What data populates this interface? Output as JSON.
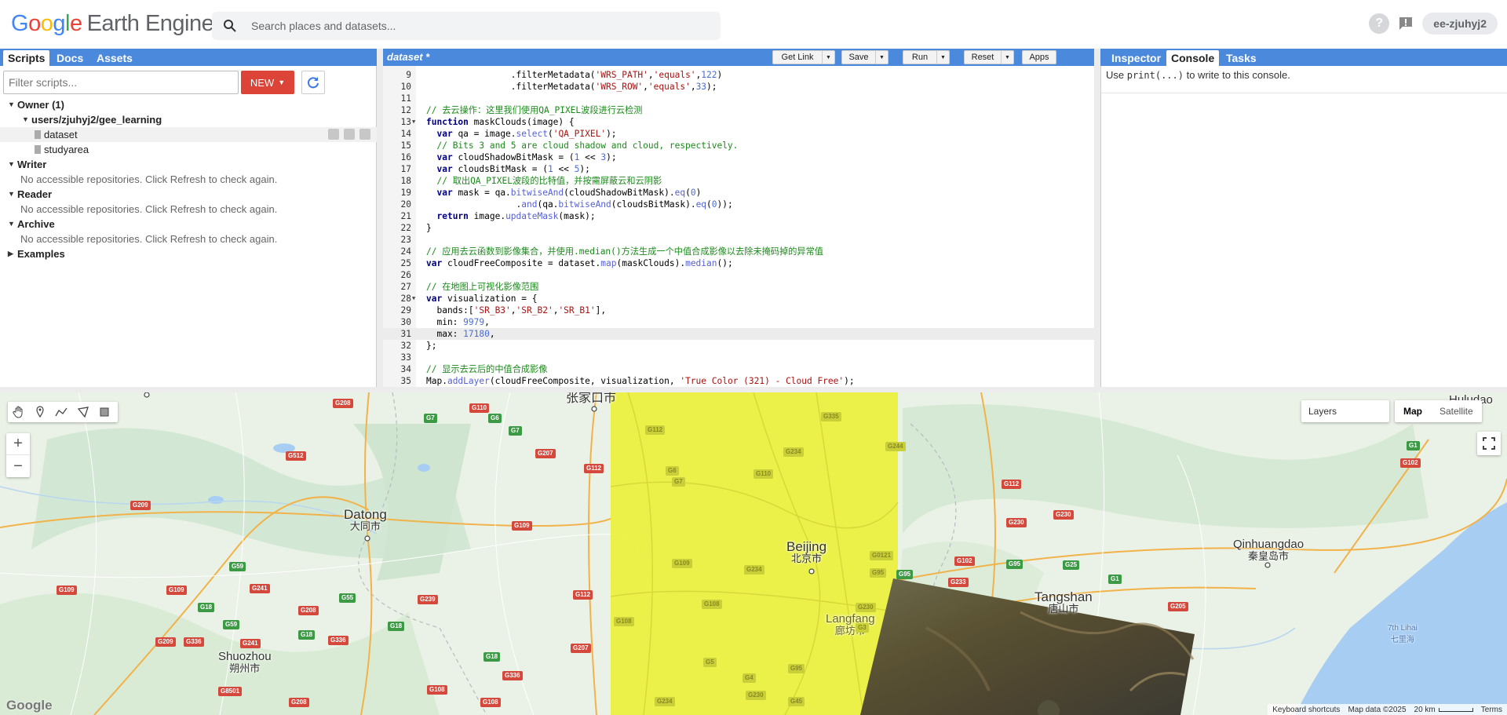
{
  "header": {
    "logo_google": "Google",
    "logo_product": "Earth Engine",
    "search_placeholder": "Search places and datasets...",
    "help_glyph": "?",
    "feedback_glyph": "!",
    "user": "ee-zjuhyj2"
  },
  "left_panel": {
    "tabs": [
      "Scripts",
      "Docs",
      "Assets"
    ],
    "active_tab": "Scripts",
    "filter_placeholder": "Filter scripts...",
    "new_label": "NEW",
    "tree": {
      "owner": "Owner (1)",
      "repo": "users/zjuhyj2/gee_learning",
      "files": [
        "dataset",
        "studyarea"
      ],
      "writer": "Writer",
      "writer_msg": "No accessible repositories. Click Refresh to check again.",
      "reader": "Reader",
      "reader_msg": "No accessible repositories. Click Refresh to check again.",
      "archive": "Archive",
      "archive_msg": "No accessible repositories. Click Refresh to check again.",
      "examples": "Examples"
    }
  },
  "editor": {
    "title": "dataset *",
    "buttons": {
      "get_link": "Get Link",
      "save": "Save",
      "run": "Run",
      "reset": "Reset",
      "apps": "Apps"
    }
  },
  "right_panel": {
    "tabs": [
      "Inspector",
      "Console",
      "Tasks"
    ],
    "active_tab": "Console",
    "console_pre": "Use ",
    "console_code": "print(...)",
    "console_post": " to write to this console."
  },
  "map": {
    "layers_label": "Layers",
    "map_types": [
      "Map",
      "Satellite"
    ],
    "active_map_type": "Map",
    "cities": {
      "datong_en": "Datong",
      "datong_zh": "大同市",
      "beijing_en": "Beijing",
      "beijing_zh": "北京市",
      "tangshan_en": "Tangshan",
      "tangshan_zh": "唐山市",
      "qinhuangdao_en": "Qinhuangdao",
      "qinhuangdao_zh": "秦皇岛市",
      "shuozhou_en": "Shuozhou",
      "shuozhou_zh": "朔州市",
      "langfang_en": "Langfang",
      "langfang_zh": "廊坊市",
      "zhangjiakou_zh": "张家口市",
      "huludao_en": "Huludao",
      "bay_en": "7th Lihai",
      "bay_zh": "七里海"
    },
    "attribution": {
      "shortcuts": "Keyboard shortcuts",
      "data": "Map data ©2025",
      "scale": "20 km",
      "terms": "Terms",
      "google": "Google"
    }
  }
}
